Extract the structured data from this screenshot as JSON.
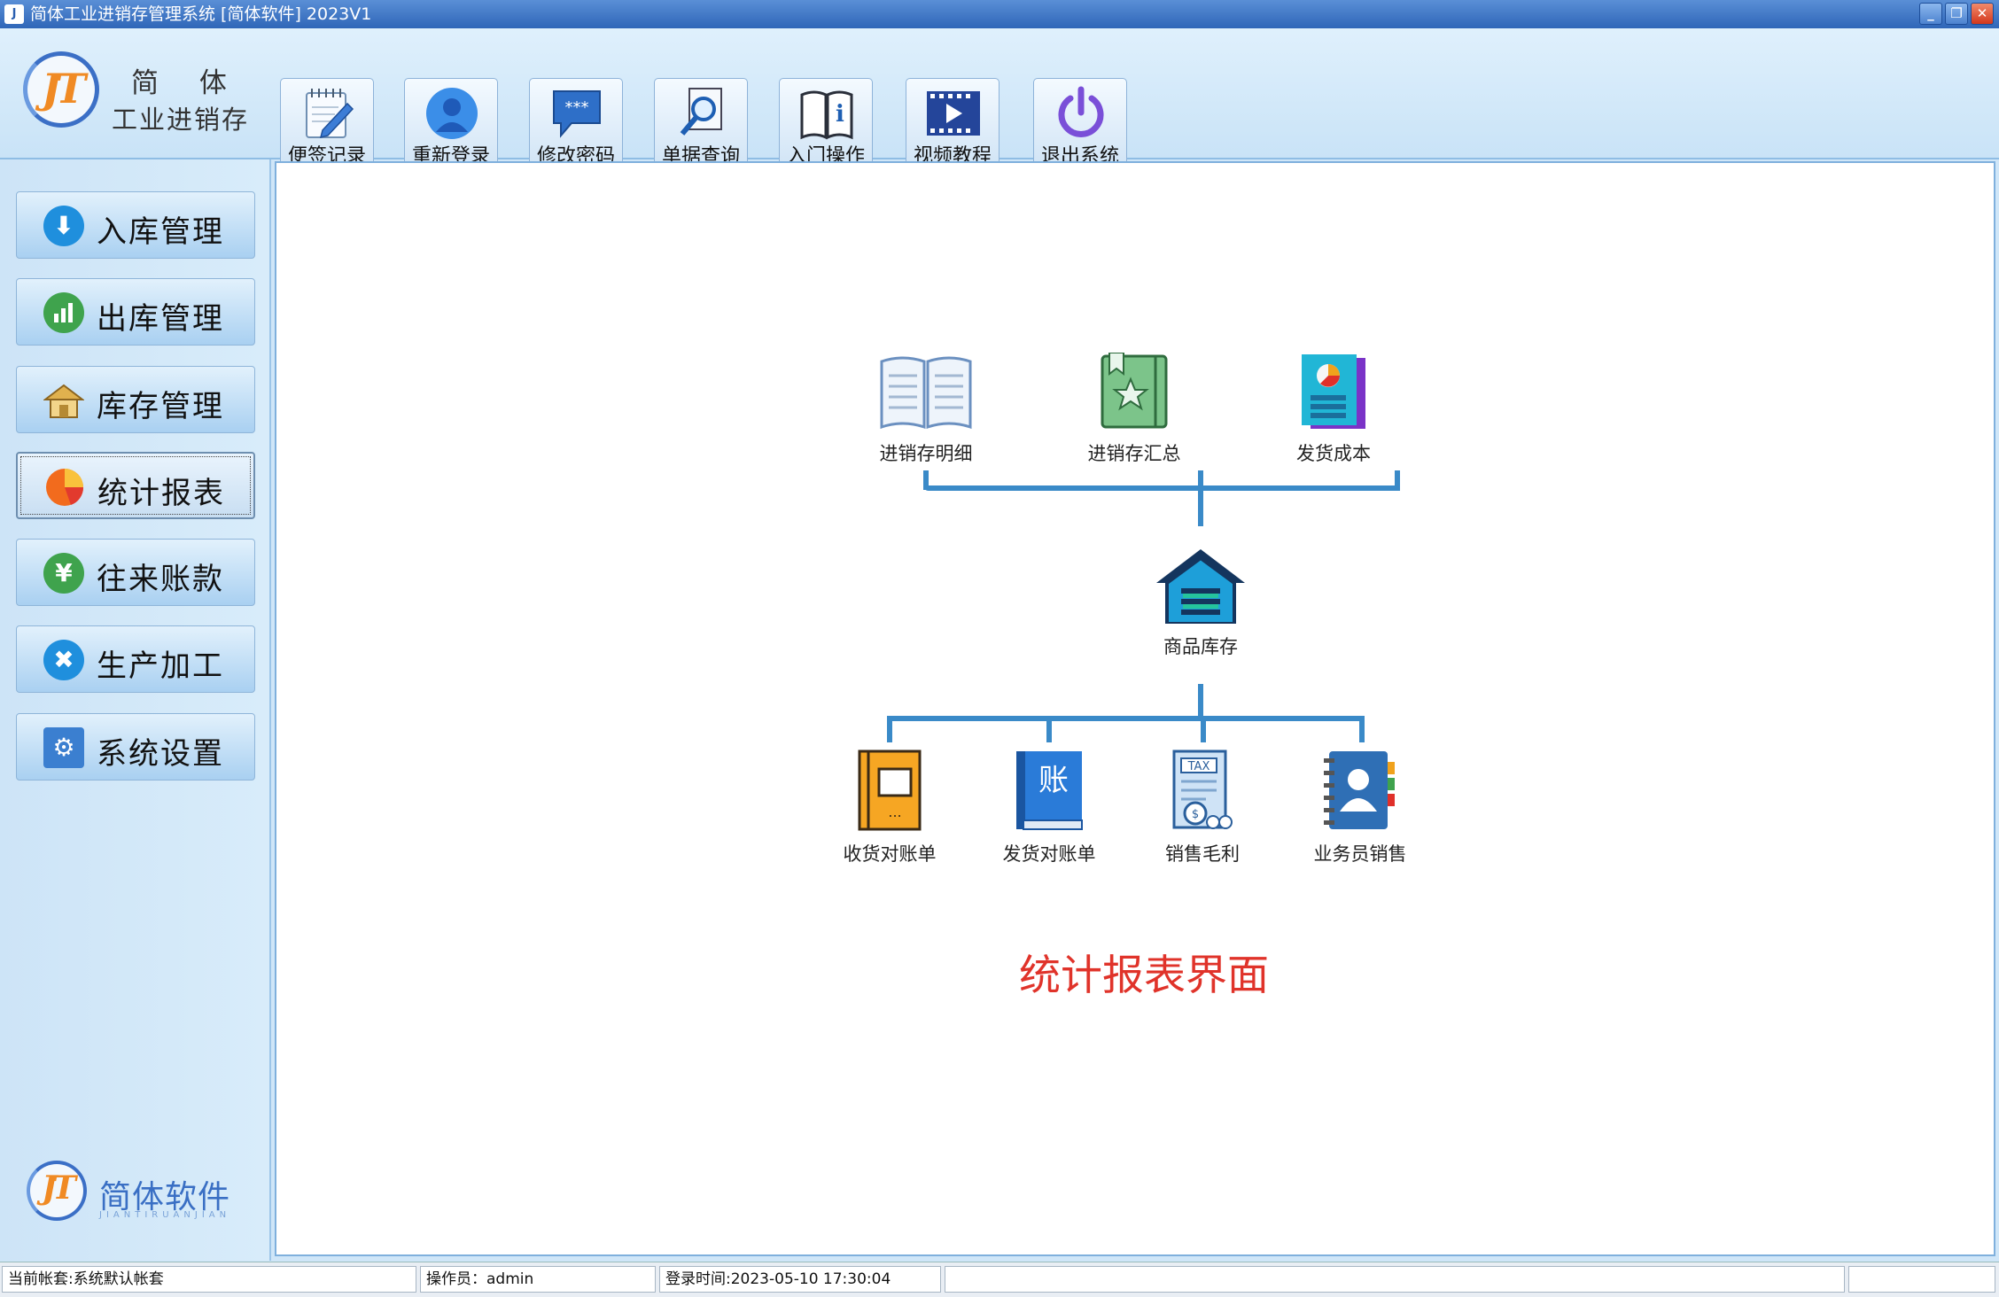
{
  "window": {
    "title": "简体工业进销存管理系统 [简体软件] 2023V1",
    "icon_name": "app-logo-icon",
    "minimize": "_",
    "restore": "❐",
    "close": "✕"
  },
  "brand": {
    "name1": "简 体",
    "name2": "工业进销存",
    "logo_text": "JT"
  },
  "toolbar": [
    {
      "label": "便签记录",
      "icon": "notepad-icon"
    },
    {
      "label": "重新登录",
      "icon": "user-icon"
    },
    {
      "label": "修改密码",
      "icon": "password-icon"
    },
    {
      "label": "单据查询",
      "icon": "search-document-icon"
    },
    {
      "label": "入门操作",
      "icon": "guide-book-icon"
    },
    {
      "label": "视频教程",
      "icon": "video-icon"
    },
    {
      "label": "退出系统",
      "icon": "power-icon"
    }
  ],
  "sidebar": {
    "items": [
      {
        "label": "入库管理",
        "icon": "download-arrow-icon",
        "color": "#1f8fdd"
      },
      {
        "label": "出库管理",
        "icon": "bar-chart-icon",
        "color": "#3fa34d"
      },
      {
        "label": "库存管理",
        "icon": "warehouse-icon",
        "color": "#d9a441"
      },
      {
        "label": "统计报表",
        "icon": "pie-chart-icon",
        "color": "#f26b1d",
        "active": true
      },
      {
        "label": "往来账款",
        "icon": "yen-icon",
        "color": "#3fa34d"
      },
      {
        "label": "生产加工",
        "icon": "tools-icon",
        "color": "#1f8fdd"
      },
      {
        "label": "系统设置",
        "icon": "gear-icon",
        "color": "#3b7fd0"
      }
    ],
    "bottom_brand": "简体软件",
    "bottom_brand_sub": "JIANTIRUANJIAN"
  },
  "main": {
    "top_nodes": [
      {
        "label": "进销存明细",
        "icon": "open-book-icon"
      },
      {
        "label": "进销存汇总",
        "icon": "green-book-star-icon"
      },
      {
        "label": "发货成本",
        "icon": "cost-report-icon"
      }
    ],
    "center_node": {
      "label": "商品库存",
      "icon": "warehouse-house-icon"
    },
    "bottom_nodes": [
      {
        "label": "收货对账单",
        "icon": "orange-ledger-icon"
      },
      {
        "label": "发货对账单",
        "icon": "blue-ledger-icon",
        "glyph": "账"
      },
      {
        "label": "销售毛利",
        "icon": "tax-document-icon",
        "glyph": "TAX"
      },
      {
        "label": "业务员销售",
        "icon": "contact-book-icon"
      }
    ],
    "caption": "统计报表界面"
  },
  "status": {
    "account": "当前帐套:系统默认帐套",
    "operator": "操作员：admin",
    "login_time": "登录时间:2023-05-10 17:30:04",
    "blank1": "",
    "blank2": ""
  }
}
